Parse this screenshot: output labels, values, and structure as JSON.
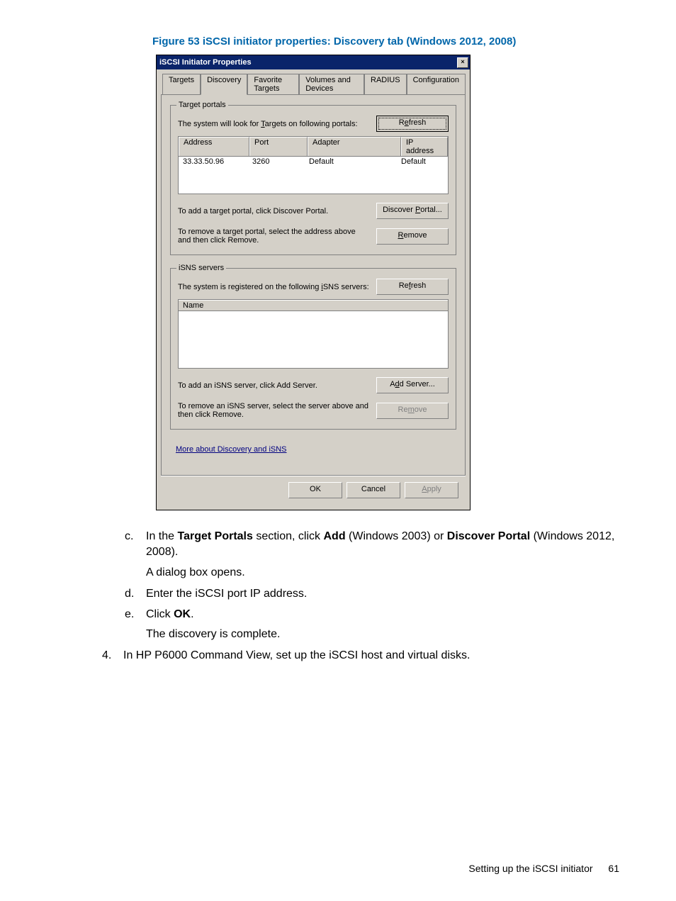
{
  "figure_caption": "Figure 53 iSCSI initiator properties: Discovery tab (Windows 2012, 2008)",
  "dialog": {
    "title": "iSCSI Initiator Properties",
    "tabs": [
      "Targets",
      "Discovery",
      "Favorite Targets",
      "Volumes and Devices",
      "RADIUS",
      "Configuration"
    ],
    "target_portals": {
      "legend": "Target portals",
      "intro": "The system will look for Targets on following portals:",
      "refresh": "Refresh",
      "columns": [
        "Address",
        "Port",
        "Adapter",
        "IP address"
      ],
      "row": {
        "address": "33.33.50.96",
        "port": "3260",
        "adapter": "Default",
        "ip": "Default"
      },
      "add_text": "To add a target portal, click Discover Portal.",
      "discover_btn": "Discover Portal...",
      "remove_text": "To remove a target portal, select the address above and then click Remove.",
      "remove_btn": "Remove"
    },
    "isns": {
      "legend": "iSNS servers",
      "intro": "The system is registered on the following iSNS servers:",
      "refresh": "Refresh",
      "column": "Name",
      "add_text": "To add an iSNS server, click Add Server.",
      "add_btn": "Add Server...",
      "remove_text": "To remove an iSNS server, select the server above and then click Remove.",
      "remove_btn": "Remove"
    },
    "help_link": "More about Discovery and iSNS",
    "ok": "OK",
    "cancel": "Cancel",
    "apply": "Apply"
  },
  "steps": {
    "c": {
      "letter": "c.",
      "t1": "In the ",
      "b1": "Target Portals",
      "t2": " section, click ",
      "b2": "Add",
      "t3": " (Windows 2003) or ",
      "b3": "Discover Portal",
      "t4": " (Windows 2012, 2008).",
      "result": "A dialog box opens."
    },
    "d": {
      "letter": "d.",
      "text": "Enter the iSCSI port IP address."
    },
    "e": {
      "letter": "e.",
      "t1": "Click ",
      "b1": "OK",
      "t2": ".",
      "result": "The discovery is complete."
    },
    "s4": {
      "num": "4.",
      "text": "In HP P6000 Command View, set up the iSCSI host and virtual disks."
    }
  },
  "footer": {
    "text": "Setting up the iSCSI initiator",
    "page": "61"
  }
}
